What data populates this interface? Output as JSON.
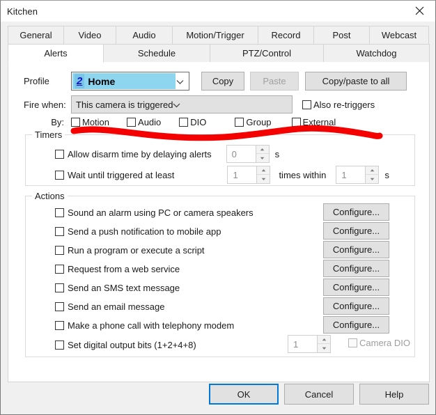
{
  "window": {
    "title": "Kitchen",
    "close_icon": "close-icon"
  },
  "tabs": {
    "row1": [
      {
        "label": "General",
        "active": false
      },
      {
        "label": "Video",
        "active": false
      },
      {
        "label": "Audio",
        "active": false
      },
      {
        "label": "Motion/Trigger",
        "active": false
      },
      {
        "label": "Record",
        "active": false
      },
      {
        "label": "Post",
        "active": false
      },
      {
        "label": "Webcast",
        "active": false
      }
    ],
    "row2": [
      {
        "label": "Alerts",
        "active": true
      },
      {
        "label": "Schedule",
        "active": false
      },
      {
        "label": "PTZ/Control",
        "active": false
      },
      {
        "label": "Watchdog",
        "active": false
      }
    ]
  },
  "profile": {
    "label": "Profile",
    "index": "2",
    "value": "Home",
    "dropdown_icon": "chevron-down-icon",
    "copy_label": "Copy",
    "paste_label": "Paste",
    "copy_paste_all_label": "Copy/paste to all"
  },
  "fire_when": {
    "label": "Fire when:",
    "value": "This camera is triggered",
    "dropdown_icon": "chevron-down-icon",
    "also_retriggers_label": "Also re-triggers"
  },
  "by": {
    "label": "By:",
    "options": [
      "Motion",
      "Audio",
      "DIO",
      "Group",
      "External"
    ]
  },
  "timers": {
    "title": "Timers",
    "disarm_label": "Allow disarm time by delaying alerts",
    "disarm_value": "0",
    "disarm_unit": "s",
    "wait_label": "Wait until triggered at least",
    "wait_count": "1",
    "times_within_label": "times within",
    "within_value": "1",
    "within_unit": "s"
  },
  "actions": {
    "title": "Actions",
    "configure_label": "Configure...",
    "items": [
      {
        "label": "Sound an alarm using PC or camera speakers",
        "configure": true
      },
      {
        "label": "Send a push notification to mobile app",
        "configure": true
      },
      {
        "label": "Run a program or execute a script",
        "configure": true
      },
      {
        "label": "Request from a web service",
        "configure": true
      },
      {
        "label": "Send an SMS text message",
        "configure": true
      },
      {
        "label": "Send an email message",
        "configure": true
      },
      {
        "label": "Make a phone call with telephony modem",
        "configure": true
      },
      {
        "label": "Set digital output bits (1+2+4+8)",
        "configure": false
      }
    ],
    "dio_value": "1",
    "camera_dio_label": "Camera DIO"
  },
  "buttons": {
    "ok": "OK",
    "cancel": "Cancel",
    "help": "Help"
  },
  "annotation": {
    "color": "#f50000",
    "type": "hand-drawn-underline"
  }
}
